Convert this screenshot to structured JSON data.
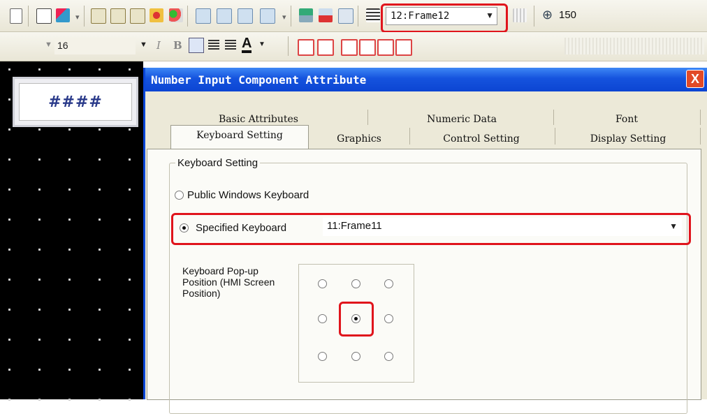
{
  "toolbar1": {
    "frame_select_value": "12:Frame12",
    "zoom_value": "150",
    "icons": [
      "page-icon",
      "open-icon",
      "paint-icon",
      "group-icon",
      "ungroup-icon",
      "break-icon",
      "camera-icon",
      "color-icon",
      "chart-icon",
      "frame-icon",
      "frame2-icon",
      "frame3-icon",
      "link-icon",
      "add-screen-icon",
      "delete-screen-icon",
      "screen-icon",
      "table-icon",
      "grid-icon",
      "zoom-icon"
    ]
  },
  "toolbar2": {
    "font_size": "16",
    "italic_label": "I",
    "bold_label": "B",
    "font_color_label": "A"
  },
  "canvas": {
    "number_display": "####"
  },
  "dialog": {
    "title": "Number Input Component Attribute",
    "close_label": "X",
    "tabs_row1": [
      "Basic Attributes",
      "Numeric Data",
      "Font"
    ],
    "tabs_row2": [
      "Keyboard Setting",
      "Graphics",
      "Control Setting",
      "Display Setting"
    ],
    "active_tab": "Keyboard Setting",
    "group_title": "Keyboard Setting",
    "option_public": "Public Windows Keyboard",
    "option_specified": "Specified Keyboard",
    "specified_selected": true,
    "keyboard_select_value": "11:Frame11",
    "popup_label": "Keyboard Pop-up Position (HMI Screen Position)",
    "popup_selected": "middle-center"
  }
}
